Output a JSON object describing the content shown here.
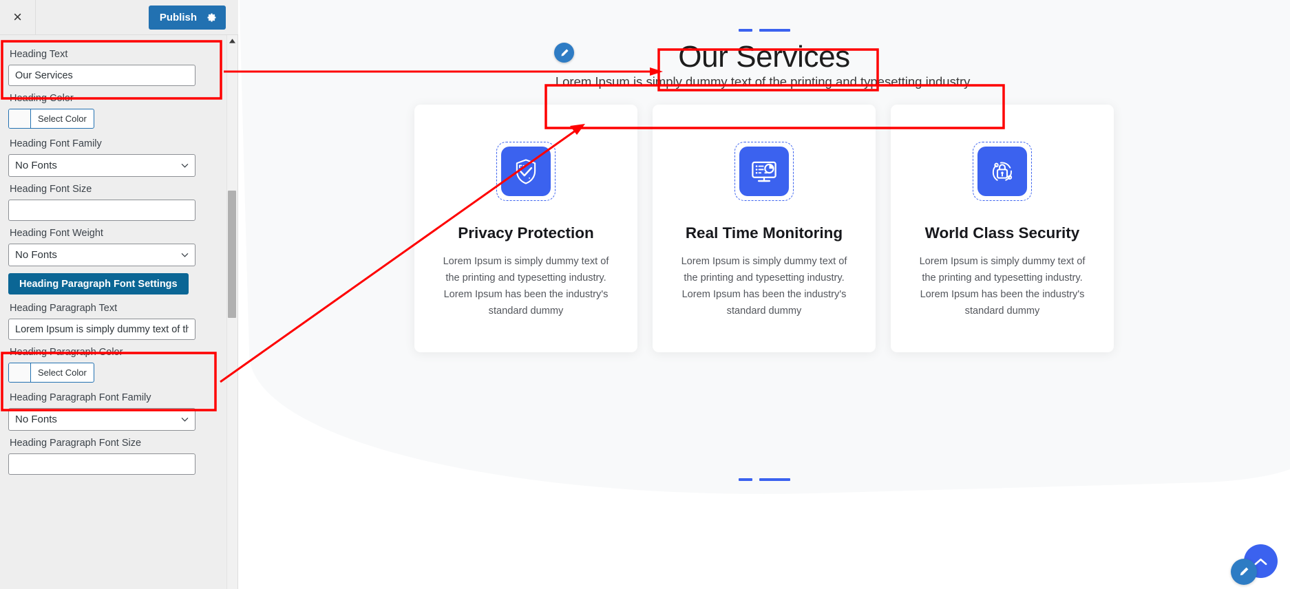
{
  "sidebar": {
    "close_label": "×",
    "close_icon": "close-icon",
    "publish_label": "Publish",
    "gear_icon": "gear-icon",
    "fields": [
      {
        "label": "Heading Text",
        "type": "text",
        "value": "Our Services",
        "highlighted": true
      },
      {
        "label": "Heading Color",
        "type": "color",
        "button_label": "Select Color",
        "swatch": "#ffffff"
      },
      {
        "label": "Heading Font Family",
        "type": "select",
        "value": "No Fonts"
      },
      {
        "label": "Heading Font Size",
        "type": "text",
        "value": ""
      },
      {
        "label": "Heading Font Weight",
        "type": "select",
        "value": "No Fonts"
      },
      {
        "label": "",
        "type": "button",
        "button_label": "Heading Paragraph Font Settings"
      },
      {
        "label": "Heading Paragraph Text",
        "type": "text",
        "value": "Lorem Ipsum is simply dummy text of th",
        "highlighted": true
      },
      {
        "label": "Heading Paragraph Color",
        "type": "color",
        "button_label": "Select Color",
        "swatch": "#ffffff"
      },
      {
        "label": "Heading Paragraph Font Family",
        "type": "select",
        "value": "No Fonts"
      },
      {
        "label": "Heading Paragraph Font Size",
        "type": "text",
        "value": ""
      }
    ],
    "scrollbar": {
      "up_icon": "scroll-up-arrow-icon"
    }
  },
  "preview": {
    "top_dashes": {
      "short": "dash-short",
      "long": "dash-long",
      "color": "#3b62ef"
    },
    "heading": "Our Services",
    "heading_edit_icon": "pencil-edit-icon",
    "paragraph": "Lorem Ipsum is simply dummy text of the printing and typesetting industry.",
    "cards": [
      {
        "icon": "shield-check-icon",
        "title": "Privacy Protection",
        "text": "Lorem Ipsum is simply dummy text of the printing and typesetting industry. Lorem Ipsum has been the industry's standard dummy"
      },
      {
        "icon": "monitor-chart-icon",
        "title": "Real Time Monitoring",
        "text": "Lorem Ipsum is simply dummy text of the printing and typesetting industry. Lorem Ipsum has been the industry's standard dummy"
      },
      {
        "icon": "lock-orbit-icon",
        "title": "World Class Security",
        "text": "Lorem Ipsum is simply dummy text of the printing and typesetting industry. Lorem Ipsum has been the industry's standard dummy"
      }
    ],
    "bottom_dashes": {
      "short": "dash-short",
      "long": "dash-long",
      "color": "#3b62ef"
    },
    "fab_edit_icon": "pencil-edit-icon",
    "fab_scroll_top_icon": "chevron-up-icon"
  },
  "annotations": {
    "color": "#fe0000",
    "boxes": [
      "heading-text-field-highlight",
      "heading-paragraph-text-field-highlight",
      "preview-heading-highlight",
      "preview-paragraph-highlight"
    ],
    "arrows": [
      "heading-text-to-preview-heading-arrow",
      "paragraph-text-to-preview-paragraph-arrow"
    ]
  }
}
